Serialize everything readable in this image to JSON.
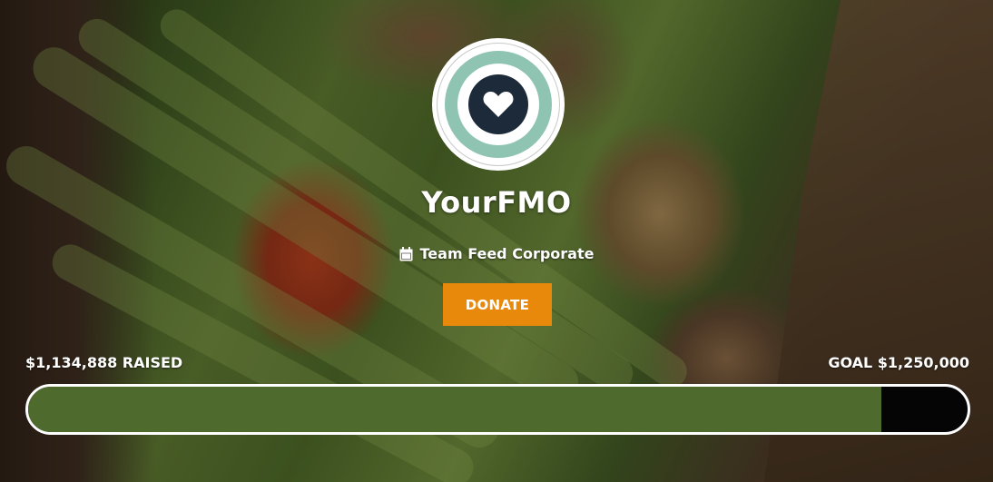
{
  "organization": {
    "name": "YourFMO",
    "team": "Team Feed Corporate",
    "logo_icon": "heart-icon"
  },
  "actions": {
    "donate_label": "DONATE"
  },
  "fundraising": {
    "raised_label": "$1,134,888 RAISED",
    "goal_label": "GOAL $1,250,000",
    "raised_amount": 1134888,
    "goal_amount": 1250000,
    "progress_fraction": 0.9079
  },
  "colors": {
    "accent": "#e8890c",
    "progress_fill": "#4e6a2c",
    "progress_track": "#050505",
    "logo_teal": "#8fc4b2",
    "logo_navy": "#1c2a3a"
  }
}
